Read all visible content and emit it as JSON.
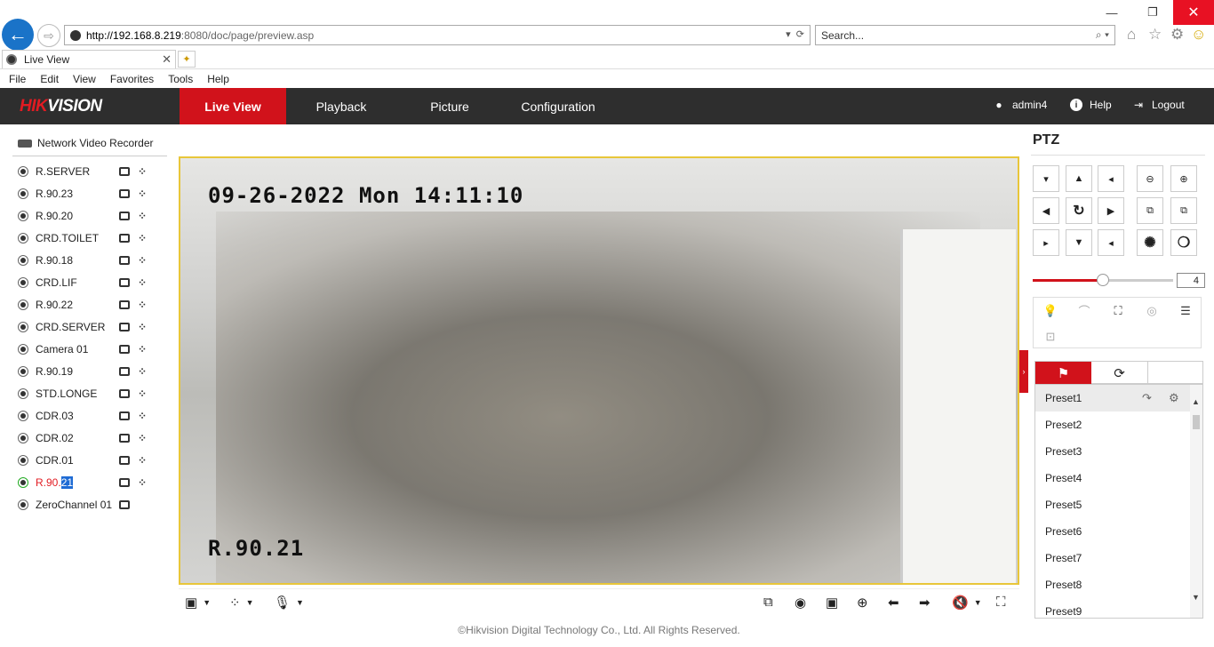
{
  "browser": {
    "url_host": "http://192.168.8.219",
    "url_rest": ":8080/doc/page/preview.asp",
    "search_placeholder": "Search...",
    "tab_title": "Live View",
    "menu": [
      "File",
      "Edit",
      "View",
      "Favorites",
      "Tools",
      "Help"
    ],
    "window_controls": {
      "minimize": "—",
      "restore": "❐",
      "close": "✕"
    }
  },
  "app": {
    "logo_red": "HIK",
    "logo_white": "VISION",
    "nav": {
      "live_view": "Live View",
      "playback": "Playback",
      "picture": "Picture",
      "configuration": "Configuration"
    },
    "user": "admin4",
    "help": "Help",
    "logout": "Logout"
  },
  "tree": {
    "root": "Network Video Recorder",
    "cameras": [
      {
        "name": "R.SERVER"
      },
      {
        "name": "R.90.23"
      },
      {
        "name": "R.90.20"
      },
      {
        "name": "CRD.TOILET"
      },
      {
        "name": "R.90.18"
      },
      {
        "name": "CRD.LIF"
      },
      {
        "name": "R.90.22"
      },
      {
        "name": "CRD.SERVER"
      },
      {
        "name": "Camera 01"
      },
      {
        "name": "R.90.19"
      },
      {
        "name": "STD.LONGE"
      },
      {
        "name": "CDR.03"
      },
      {
        "name": "CDR.02"
      },
      {
        "name": "CDR.01"
      }
    ],
    "active_camera": {
      "prefix": "R.90.",
      "selected": "21"
    },
    "zero_channel": "ZeroChannel 01"
  },
  "video": {
    "osd_time": "09-26-2022 Mon 14:11:10",
    "osd_name": "R.90.21"
  },
  "footer": "©Hikvision Digital Technology Co., Ltd. All Rights Reserved.",
  "ptz": {
    "title": "PTZ",
    "speed": "4",
    "speed_fraction": 0.5,
    "presets": [
      "Preset1",
      "Preset2",
      "Preset3",
      "Preset4",
      "Preset5",
      "Preset6",
      "Preset7",
      "Preset8",
      "Preset9"
    ]
  },
  "colors": {
    "accent": "#d1121b",
    "header_bg": "#2e2e2e",
    "video_border": "#e8c63a"
  }
}
